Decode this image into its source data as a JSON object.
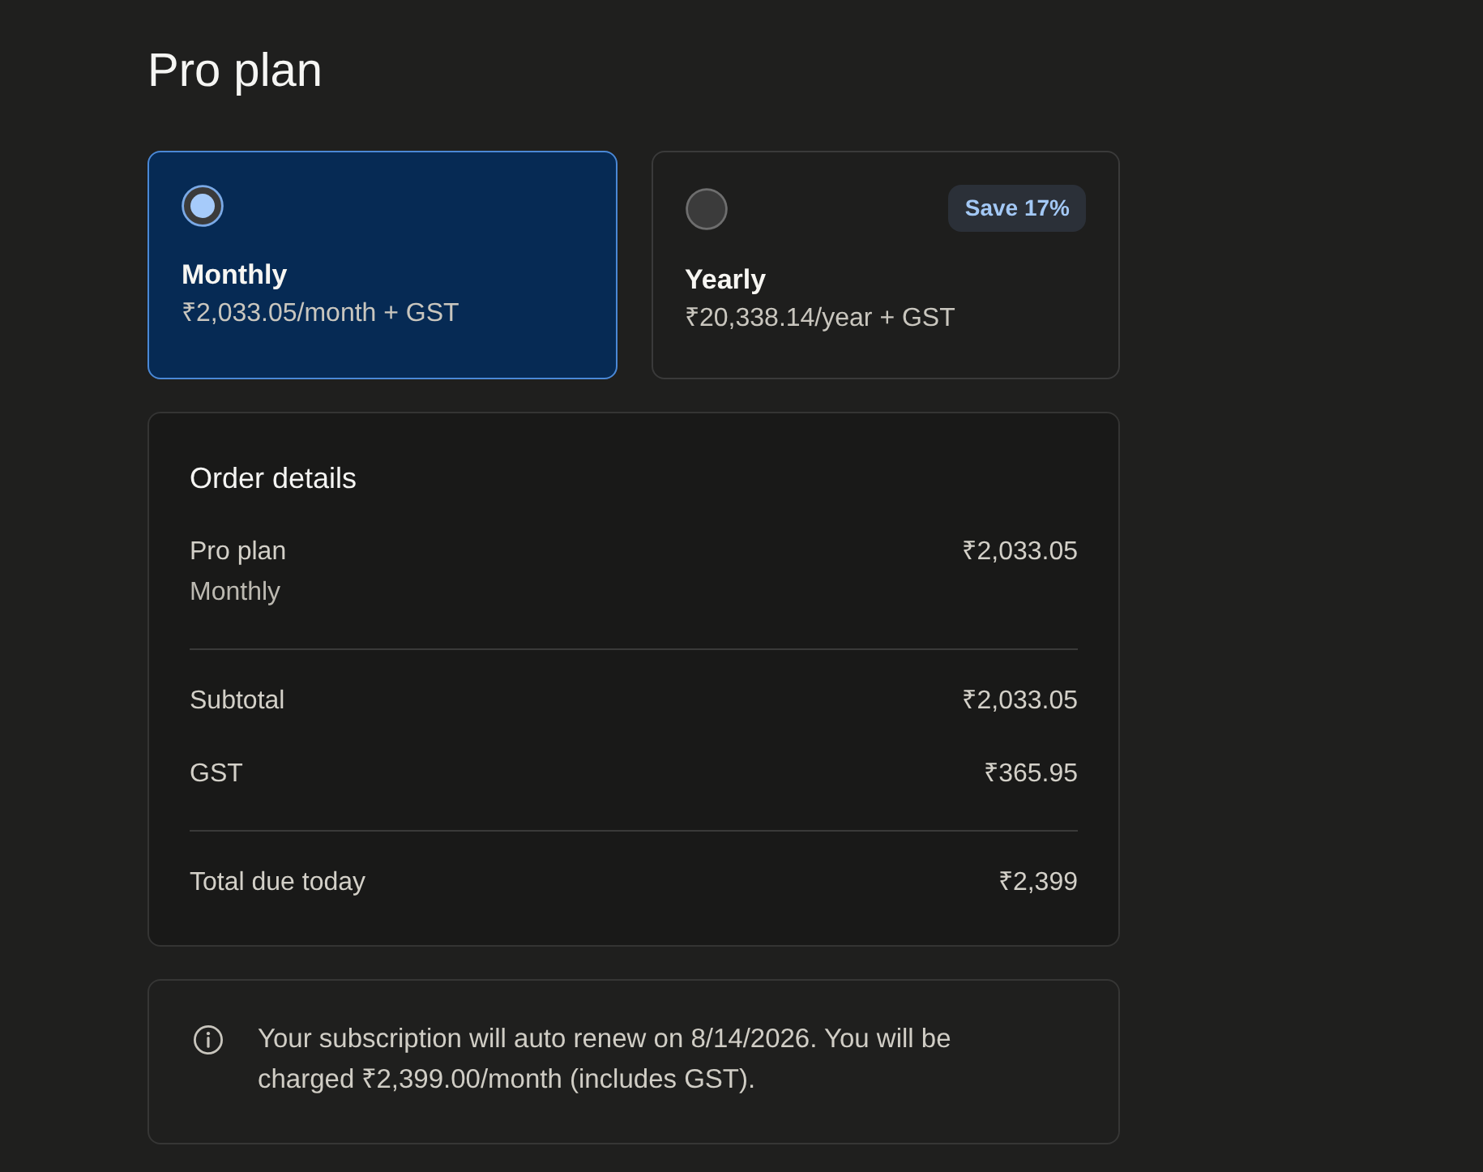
{
  "title": "Pro plan",
  "plans": [
    {
      "name": "Monthly",
      "price": "₹2,033.05/month + GST",
      "selected": true
    },
    {
      "name": "Yearly",
      "price": "₹20,338.14/year + GST",
      "selected": false,
      "badge": "Save 17%"
    }
  ],
  "order_details": {
    "title": "Order details",
    "items": [
      {
        "label": "Pro plan",
        "sublabel": "Monthly",
        "amount": "₹2,033.05"
      }
    ],
    "summary": [
      {
        "label": "Subtotal",
        "amount": "₹2,033.05"
      },
      {
        "label": "GST",
        "amount": "₹365.95"
      }
    ],
    "total": {
      "label": "Total due today",
      "amount": "₹2,399"
    }
  },
  "notice": {
    "text": "Your subscription will auto renew on 8/14/2026. You will be charged ₹2,399.00/month (includes GST)."
  }
}
